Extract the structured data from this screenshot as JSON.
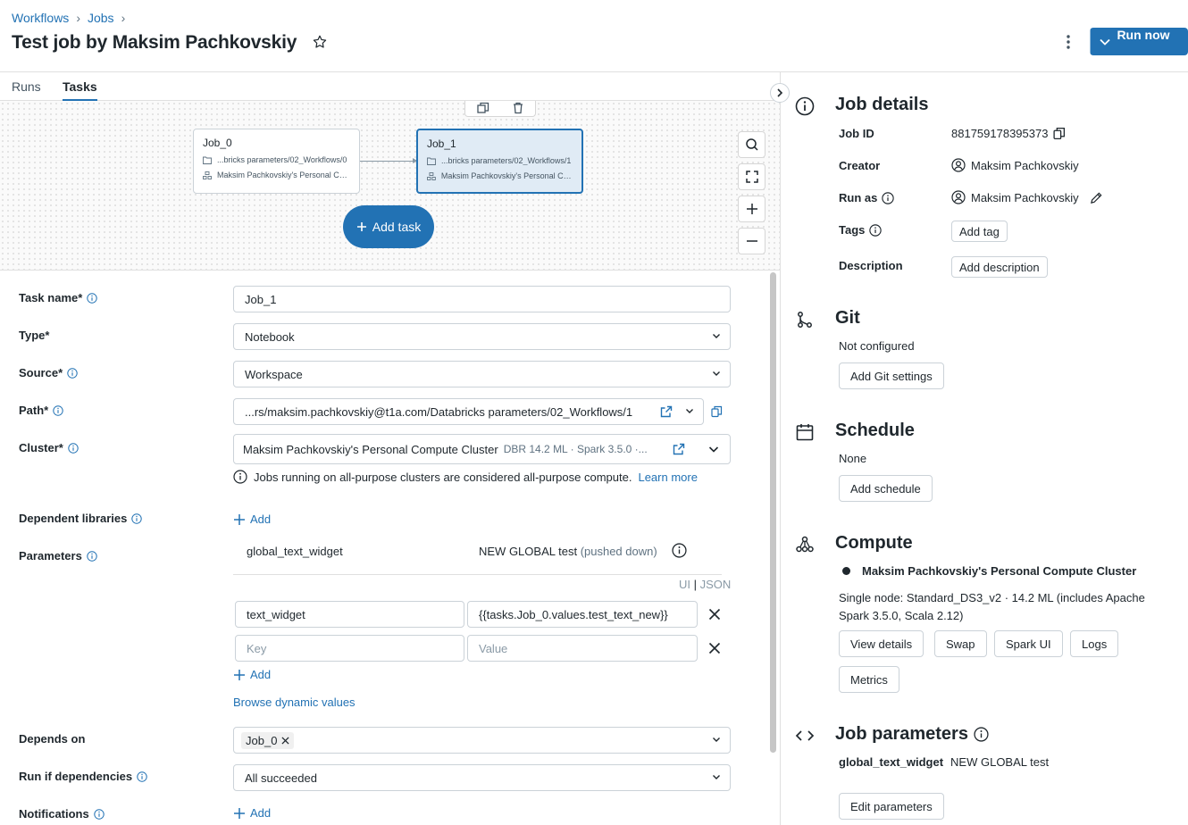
{
  "header": {
    "breadcrumb": [
      "Workflows",
      "Jobs"
    ],
    "title": "Test job by Maksim Pachkovskiy",
    "run_now": "Run now"
  },
  "tabs": [
    "Runs",
    "Tasks"
  ],
  "canvas": {
    "nodes": [
      {
        "name": "Job_0",
        "path": "...bricks parameters/02_Workflows/0",
        "cluster": "Maksim Pachkovskiy's Personal Co..."
      },
      {
        "name": "Job_1",
        "path": "...bricks parameters/02_Workflows/1",
        "cluster": "Maksim Pachkovskiy's Personal Co..."
      }
    ],
    "add_task": "Add task"
  },
  "form": {
    "task_name_label": "Task name*",
    "task_name_value": "Job_1",
    "type_label": "Type*",
    "type_value": "Notebook",
    "source_label": "Source*",
    "source_value": "Workspace",
    "path_label": "Path*",
    "path_value": "...rs/maksim.pachkovskiy@t1a.com/Databricks parameters/02_Workflows/1",
    "cluster_label": "Cluster*",
    "cluster_value": "Maksim Pachkovskiy's Personal Compute Cluster",
    "cluster_meta": "DBR 14.2 ML · Spark 3.5.0 ·...",
    "cluster_note": "Jobs running on all-purpose clusters are considered all-purpose compute.",
    "learn_more": "Learn more",
    "dependent_libraries_label": "Dependent libraries",
    "add": "Add",
    "parameters_label": "Parameters",
    "global_param_key": "global_text_widget",
    "global_param_value": "NEW GLOBAL test",
    "pushed_down": "(pushed down)",
    "ui_toggle": "UI",
    "toggle_sep": "|",
    "json_toggle": "JSON",
    "param_key": "text_widget",
    "param_value": "{{tasks.Job_0.values.test_text_new}}",
    "key_placeholder": "Key",
    "value_placeholder": "Value",
    "browse_dynamic": "Browse dynamic values",
    "depends_on_label": "Depends on",
    "depends_on_value": "Job_0",
    "run_if_label": "Run if dependencies",
    "run_if_value": "All succeeded",
    "notifications_label": "Notifications"
  },
  "details": {
    "title": "Job details",
    "job_id_label": "Job ID",
    "job_id": "881759178395373",
    "creator_label": "Creator",
    "creator": "Maksim Pachkovskiy",
    "run_as_label": "Run as",
    "run_as": "Maksim Pachkovskiy",
    "tags_label": "Tags",
    "add_tag": "Add tag",
    "description_label": "Description",
    "add_description": "Add description"
  },
  "git": {
    "title": "Git",
    "status": "Not configured",
    "button": "Add Git settings"
  },
  "schedule": {
    "title": "Schedule",
    "status": "None",
    "button": "Add schedule"
  },
  "compute": {
    "title": "Compute",
    "cluster": "Maksim Pachkovskiy's Personal Compute Cluster",
    "desc_line1": "Single node: Standard_DS3_v2 · 14.2 ML (includes Apache",
    "desc_line2": "Spark 3.5.0, Scala 2.12)",
    "buttons": [
      "View details",
      "Swap",
      "Spark UI",
      "Logs",
      "Metrics"
    ]
  },
  "job_params": {
    "title": "Job parameters",
    "key": "global_text_widget",
    "value": "NEW GLOBAL test",
    "button": "Edit parameters"
  },
  "colors": {
    "accent": "#2272b4",
    "border": "#cbd2d8",
    "text": "#1f272d"
  }
}
